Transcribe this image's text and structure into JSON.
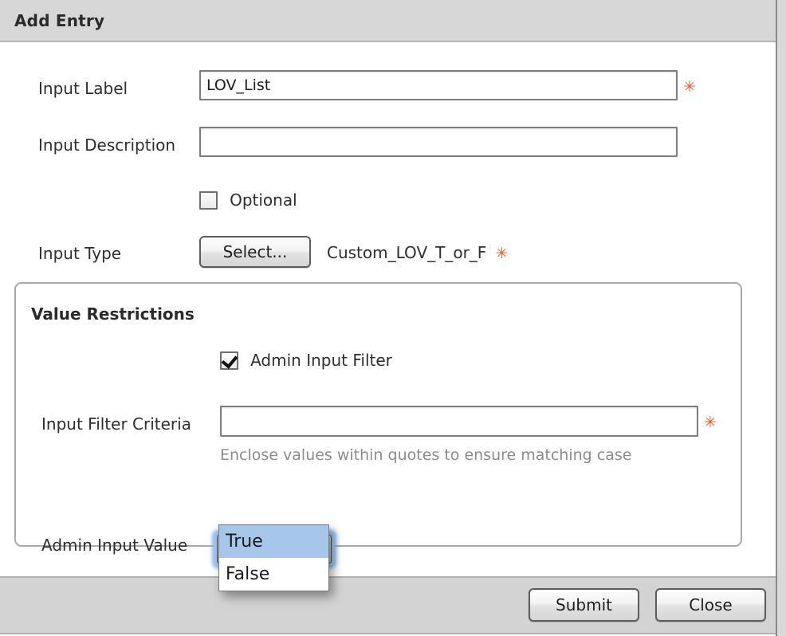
{
  "dialog": {
    "title": "Add Entry"
  },
  "form": {
    "input_label": {
      "label": "Input Label",
      "value": "LOV_List",
      "placeholder": "",
      "required_marker": "✳"
    },
    "input_description": {
      "label": "Input Description",
      "value": "",
      "placeholder": ""
    },
    "optional": {
      "label": "Optional",
      "checked": false
    },
    "input_type": {
      "label": "Input Type",
      "select_button_label": "Select...",
      "selected_type": "Custom_LOV_T_or_F",
      "required_marker": "✳"
    }
  },
  "value_restrictions": {
    "legend": "Value Restrictions",
    "admin_input_filter": {
      "label": "Admin Input Filter",
      "checked": true
    },
    "input_filter_criteria": {
      "label": "Input Filter Criteria",
      "value": "",
      "placeholder": "",
      "required_marker": "✳",
      "hint": "Enclose values within quotes to ensure matching case"
    },
    "admin_input_value": {
      "label": "Admin Input Value",
      "selected": "True",
      "expanded": true,
      "options": [
        "True",
        "False"
      ],
      "highlighted_option": "True"
    }
  },
  "footer": {
    "submit_label": "Submit",
    "close_label": "Close"
  },
  "colors": {
    "required_marker": "#f4511e",
    "header_background": "#d7d7d7",
    "footer_background": "#d3d3d3",
    "dropdown_highlight": "#a7c7ea",
    "focus_glow": "#9fc8f2",
    "hint_text": "#8b8b8b"
  }
}
